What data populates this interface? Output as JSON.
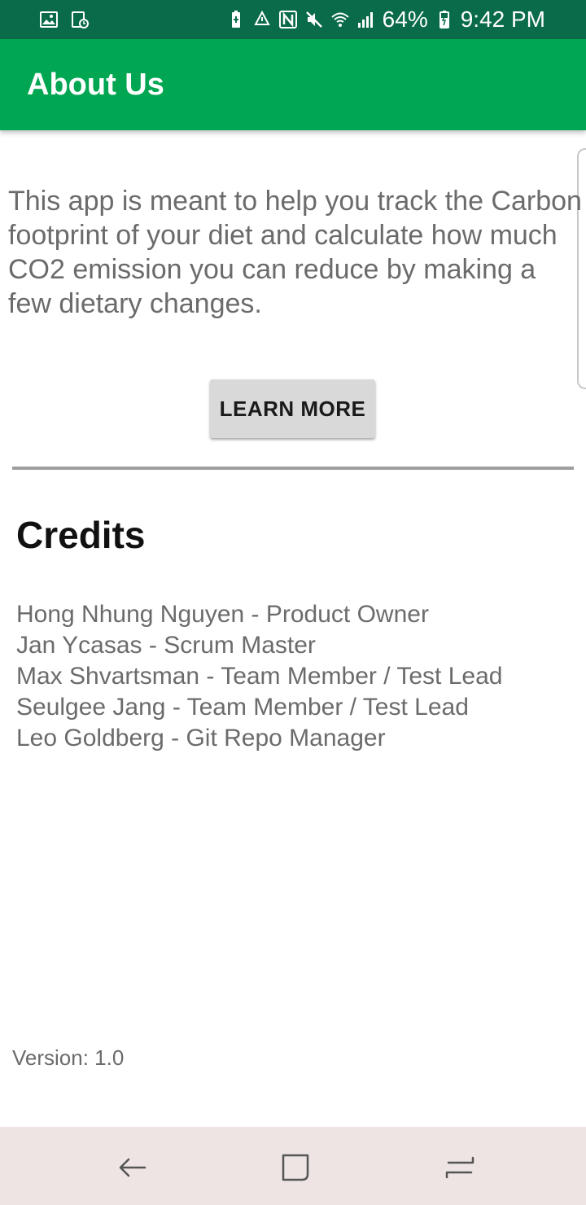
{
  "status_bar": {
    "battery": "64%",
    "time": "9:42 PM",
    "left_icons": [
      "image-icon",
      "calendar-icon"
    ],
    "right_icons": [
      "battery-saver-icon",
      "recycle-icon",
      "nfc-icon",
      "mute-icon",
      "wifi-icon",
      "signal-icon",
      "battery-icon"
    ]
  },
  "app_bar": {
    "title": "About Us"
  },
  "about": {
    "description": "This app is meant to help you track the Carbon footprint of your diet and calculate how much CO2 emission you can reduce by making a few dietary changes.",
    "learn_more_label": "LEARN MORE"
  },
  "credits": {
    "title": "Credits",
    "members": [
      "Hong Nhung Nguyen - Product Owner",
      "Jan Ycasas - Scrum Master",
      "Max Shvartsman - Team Member / Test Lead",
      "Seulgee Jang - Team Member / Test Lead",
      "Leo Goldberg - Git Repo Manager"
    ]
  },
  "footer": {
    "version": "Version: 1.0"
  },
  "nav_bar": {
    "buttons": [
      "back-icon",
      "home-icon",
      "recent-apps-icon"
    ]
  },
  "colors": {
    "status_bar": "#0a6b4b",
    "app_bar": "#00a651",
    "nav_bar": "#efe4e4",
    "body_text": "#6b6b6b",
    "button_bg": "#d9d9d9"
  }
}
